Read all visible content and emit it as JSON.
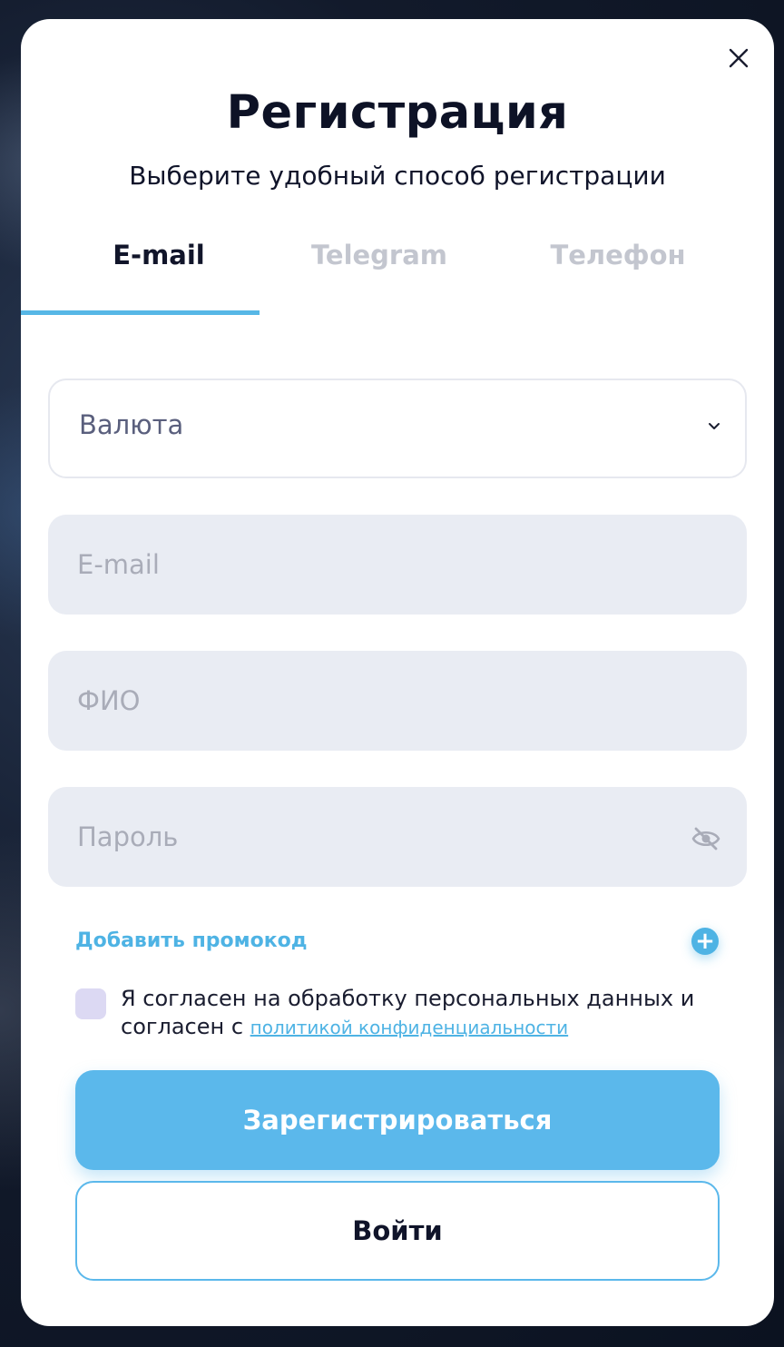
{
  "modal": {
    "title": "Регистрация",
    "subtitle": "Выберите удобный способ регистрации",
    "close_icon": "close-icon"
  },
  "tabs": [
    {
      "label": "E-mail",
      "active": true
    },
    {
      "label": "Telegram",
      "active": false
    },
    {
      "label": "Телефон",
      "active": false
    }
  ],
  "form": {
    "currency": {
      "label": "Валюта",
      "icon": "chevron-down-icon"
    },
    "email": {
      "placeholder": "E-mail",
      "value": ""
    },
    "fio": {
      "placeholder": "ФИО",
      "value": ""
    },
    "password": {
      "placeholder": "Пароль",
      "value": "",
      "icon": "eye-off-icon"
    },
    "promo": {
      "label": "Добавить промокод",
      "icon": "plus-icon"
    },
    "consent": {
      "checked": false,
      "text": "Я согласен на обработку персональных данных и согласен с ",
      "link_text": "политикой конфиденциальности"
    },
    "register_label": "Зарегистрироваться",
    "login_label": "Войти"
  },
  "colors": {
    "accent": "#5bb8eb",
    "title": "#0d1226",
    "input_bg": "#e9ecf3",
    "tab_inactive": "#c3c6cf",
    "checkbox_bg": "#dcd9f3"
  }
}
